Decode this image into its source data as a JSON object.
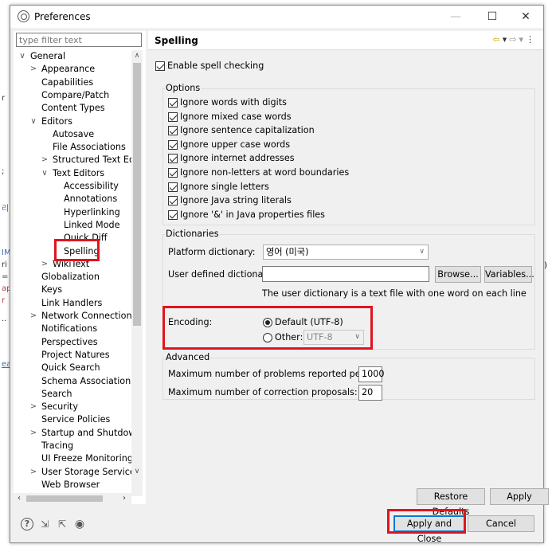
{
  "window": {
    "title": "Preferences",
    "minimize": "—",
    "maximize": "☐",
    "close": "✕"
  },
  "background": [
    "r",
    ";",
    "리",
    "IM",
    "ri",
    "=",
    "ap",
    "r",
    "..",
    "ea",
    ")"
  ],
  "filter": {
    "placeholder": "type filter text"
  },
  "tree": [
    {
      "label": "General",
      "twisty": "∨"
    },
    {
      "label": "Appearance",
      "twisty": ">"
    },
    {
      "label": "Capabilities",
      "twisty": ""
    },
    {
      "label": "Compare/Patch",
      "twisty": ""
    },
    {
      "label": "Content Types",
      "twisty": ""
    },
    {
      "label": "Editors",
      "twisty": "∨"
    },
    {
      "label": "Autosave",
      "twisty": ""
    },
    {
      "label": "File Associations",
      "twisty": ""
    },
    {
      "label": "Structured Text Edito",
      "twisty": ">"
    },
    {
      "label": "Text Editors",
      "twisty": "∨"
    },
    {
      "label": "Accessibility",
      "twisty": ""
    },
    {
      "label": "Annotations",
      "twisty": ""
    },
    {
      "label": "Hyperlinking",
      "twisty": ""
    },
    {
      "label": "Linked Mode",
      "twisty": ""
    },
    {
      "label": "Quick Diff",
      "twisty": ""
    },
    {
      "label": "Spelling",
      "twisty": ""
    },
    {
      "label": "WikiText",
      "twisty": ">"
    },
    {
      "label": "Globalization",
      "twisty": ""
    },
    {
      "label": "Keys",
      "twisty": ""
    },
    {
      "label": "Link Handlers",
      "twisty": ""
    },
    {
      "label": "Network Connections",
      "twisty": ">"
    },
    {
      "label": "Notifications",
      "twisty": ""
    },
    {
      "label": "Perspectives",
      "twisty": ""
    },
    {
      "label": "Project Natures",
      "twisty": ""
    },
    {
      "label": "Quick Search",
      "twisty": ""
    },
    {
      "label": "Schema Associations",
      "twisty": ""
    },
    {
      "label": "Search",
      "twisty": ""
    },
    {
      "label": "Security",
      "twisty": ">"
    },
    {
      "label": "Service Policies",
      "twisty": ""
    },
    {
      "label": "Startup and Shutdown",
      "twisty": ">"
    },
    {
      "label": "Tracing",
      "twisty": ""
    },
    {
      "label": "UI Freeze Monitoring",
      "twisty": ""
    },
    {
      "label": "User Storage Service",
      "twisty": ">"
    },
    {
      "label": "Web Browser",
      "twisty": ""
    }
  ],
  "page": {
    "title": "Spelling",
    "enable_spell_checking": "Enable spell checking",
    "options": {
      "title": "Options",
      "items": [
        "Ignore words with digits",
        "Ignore mixed case words",
        "Ignore sentence capitalization",
        "Ignore upper case words",
        "Ignore internet addresses",
        "Ignore non-letters at word boundaries",
        "Ignore single letters",
        "Ignore Java string literals",
        "Ignore '&' in Java properties files"
      ]
    },
    "dictionaries": {
      "title": "Dictionaries",
      "platform_label": "Platform dictionary:",
      "platform_value": "영어 (미국)",
      "user_label": "User defined dictionary:",
      "user_value": "",
      "browse": "Browse...",
      "variables": "Variables...",
      "note": "The user dictionary is a text file with one word on each line"
    },
    "encoding": {
      "label": "Encoding:",
      "default": "Default (UTF-8)",
      "other": "Other:",
      "other_value": "UTF-8"
    },
    "advanced": {
      "title": "Advanced",
      "max_problems_label": "Maximum number of problems reported per file:",
      "max_problems_value": "1000",
      "max_proposals_label": "Maximum number of correction proposals:",
      "max_proposals_value": "20"
    },
    "restore_defaults": "Restore Defaults",
    "apply": "Apply"
  },
  "footer": {
    "apply_and_close": "Apply and Close",
    "cancel": "Cancel"
  },
  "colors": {
    "highlight": "#e0141e",
    "accent": "#0078d7"
  }
}
